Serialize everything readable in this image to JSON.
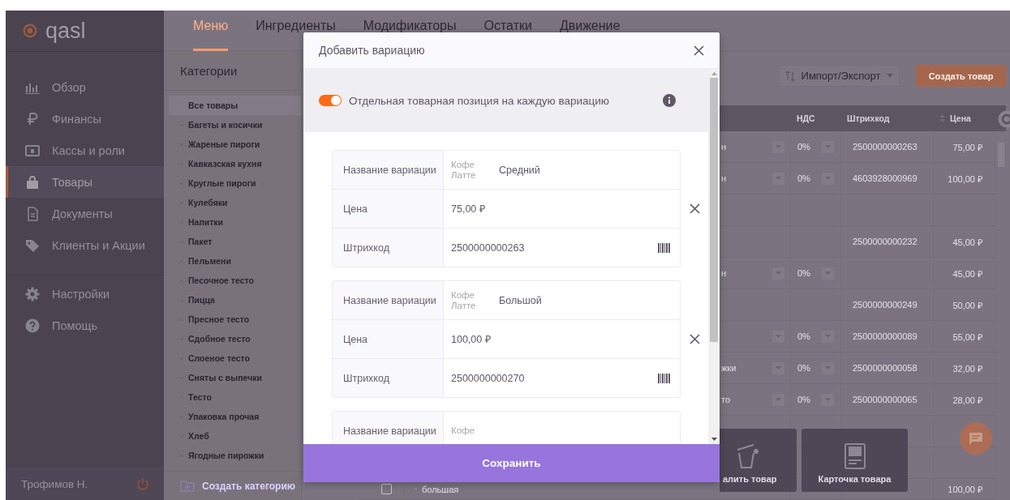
{
  "sidebar": {
    "logo": "qasl",
    "items": [
      {
        "label": "Обзор",
        "selected": false
      },
      {
        "label": "Финансы",
        "selected": false
      },
      {
        "label": "Кассы и роли",
        "selected": false
      },
      {
        "label": "Товары",
        "selected": true
      },
      {
        "label": "Документы",
        "selected": false
      },
      {
        "label": "Клиенты и Акции",
        "selected": false
      }
    ],
    "extra_items": [
      {
        "label": "Настройки",
        "selected": false
      },
      {
        "label": "Помощь",
        "selected": false
      }
    ],
    "user": "Трофимов Н."
  },
  "tabs": [
    {
      "label": "Меню",
      "selected": true
    },
    {
      "label": "Ингредиенты",
      "selected": false
    },
    {
      "label": "Модификаторы",
      "selected": false
    },
    {
      "label": "Остатки",
      "selected": false
    },
    {
      "label": "Движение",
      "selected": false
    }
  ],
  "categories": {
    "title": "Категории",
    "items": [
      {
        "label": "Все товары",
        "selected": true
      },
      {
        "label": "Багеты и косички",
        "selected": false
      },
      {
        "label": "Жареные пироги",
        "selected": false
      },
      {
        "label": "Кавказская кухня",
        "selected": false
      },
      {
        "label": "Круглые пироги",
        "selected": false
      },
      {
        "label": "Кулебяки",
        "selected": false
      },
      {
        "label": "Напитки",
        "selected": false
      },
      {
        "label": "Пакет",
        "selected": false
      },
      {
        "label": "Пельмени",
        "selected": false
      },
      {
        "label": "Песочное тесто",
        "selected": false
      },
      {
        "label": "Пицца",
        "selected": false
      },
      {
        "label": "Пресное тесто",
        "selected": false
      },
      {
        "label": "Сдобное тесто",
        "selected": false
      },
      {
        "label": "Слоеное тесто",
        "selected": false
      },
      {
        "label": "Сняты с выпечки",
        "selected": false
      },
      {
        "label": "Тесто",
        "selected": false
      },
      {
        "label": "Упаковка прочая",
        "selected": false
      },
      {
        "label": "Хлеб",
        "selected": false
      },
      {
        "label": "Ягодные пирожки",
        "selected": false
      }
    ],
    "create_button": "Создать категорию"
  },
  "toolbar": {
    "import_export_button": "Импорт/Экспорт",
    "create_button": "Создать товар"
  },
  "table": {
    "columns": [
      "НДС",
      "Штрихкод",
      "Цена"
    ],
    "rows": [
      {
        "kind": "select",
        "column_1": "н",
        "vat": "0%",
        "barcode": "2500000000263",
        "price": "75,00 ₽"
      },
      {
        "kind": "select",
        "column_1": "н",
        "vat": "0%",
        "barcode": "4603928000969",
        "price": "100,00 ₽"
      },
      {
        "kind": "blank"
      },
      {
        "kind": "plain",
        "barcode": "2500000000232",
        "price": "45,00 ₽"
      },
      {
        "kind": "select",
        "column_1": "н",
        "vat": "0%",
        "price": "45,00 ₽"
      },
      {
        "kind": "plain",
        "barcode": "2500000000249",
        "price": "50,00 ₽"
      },
      {
        "kind": "select",
        "vat": "0%",
        "barcode": "2500000000089",
        "price": "55,00 ₽"
      },
      {
        "kind": "select",
        "column_1": "жки",
        "vat": "0%",
        "barcode": "2500000000058",
        "price": "32,00 ₽"
      },
      {
        "kind": "select",
        "column_1": "то",
        "vat": "0%",
        "barcode": "2500000000065",
        "price": "28,00 ₽"
      },
      {
        "kind": "blank"
      },
      {
        "kind": "blank"
      },
      {
        "kind": "item",
        "checked": false,
        "column_1": "большая",
        "price": "100,00 ₽"
      }
    ]
  },
  "actions": [
    {
      "kind": "delete",
      "label": "алить товар"
    },
    {
      "kind": "card",
      "label": "Карточка товара"
    }
  ],
  "modal": {
    "title": "Добавить вариацию",
    "toggle": {
      "label": "Отдельная товарная позиция на каждую вариацию",
      "on": true
    },
    "variations": [
      {
        "name_label": "Название вариации",
        "prefix": "Кофе Латте",
        "name": "Средний",
        "price_label": "Цена",
        "price": "75,00 ₽",
        "barcode_label": "Штрихкод",
        "barcode": "2500000000263"
      },
      {
        "name_label": "Название вариации",
        "prefix": "Кофе Латте",
        "name": "Большой",
        "price_label": "Цена",
        "price": "100,00 ₽",
        "barcode_label": "Штрихкод",
        "barcode": "2500000000270"
      },
      {
        "name_label": "Название вариации",
        "prefix": "Кофе"
      }
    ],
    "save_button": "Сохранить"
  }
}
